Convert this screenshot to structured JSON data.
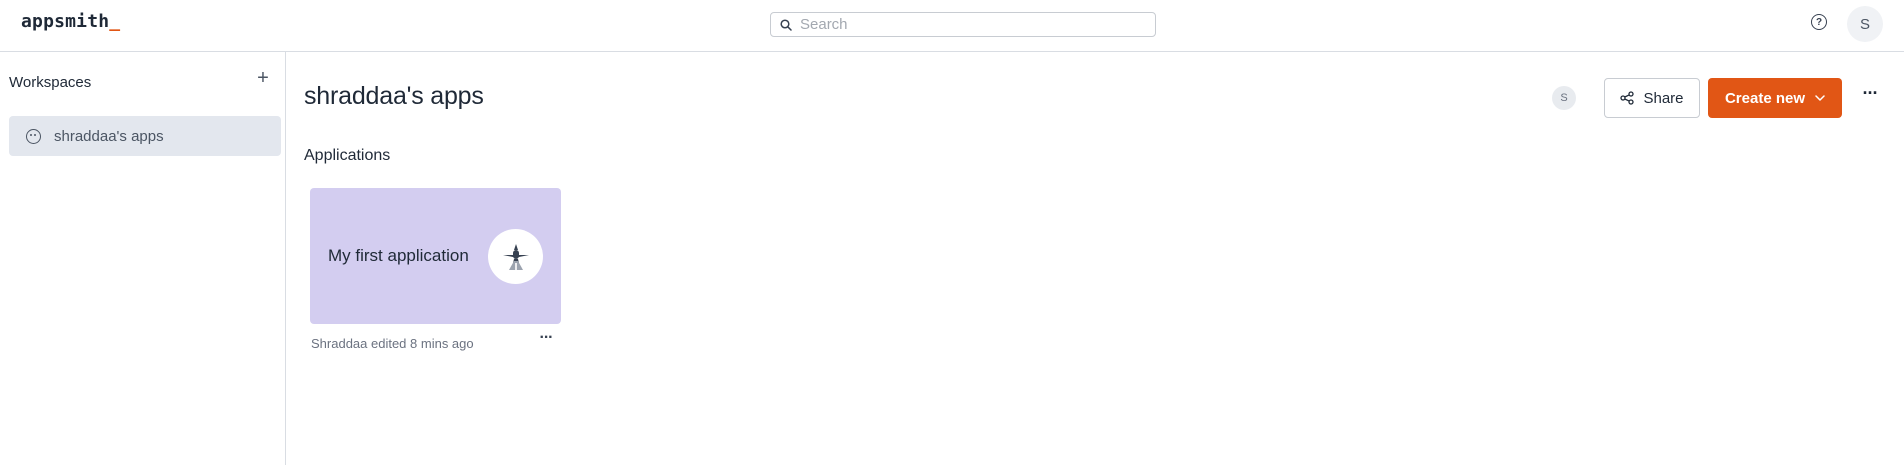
{
  "header": {
    "logo_text": "appsmith",
    "logo_cursor": "_",
    "search_placeholder": "Search",
    "help_icon": "question-circle-icon",
    "user_initial": "S"
  },
  "sidebar": {
    "title": "Workspaces",
    "add_icon": "plus-icon",
    "workspaces": [
      {
        "label": "shraddaa's apps",
        "icon": "smile-icon",
        "selected": true
      }
    ]
  },
  "main": {
    "title": "shraddaa's apps",
    "member_initial": "S",
    "share_label": "Share",
    "create_label": "Create new",
    "section_title": "Applications",
    "applications": [
      {
        "name": "My first application",
        "meta": "Shraddaa edited 8 mins ago",
        "icon": "airplane-icon"
      }
    ]
  },
  "colors": {
    "accent": "#e15615",
    "card_background": "#d3cdf0",
    "selected_workspace": "#e3e7ee"
  }
}
